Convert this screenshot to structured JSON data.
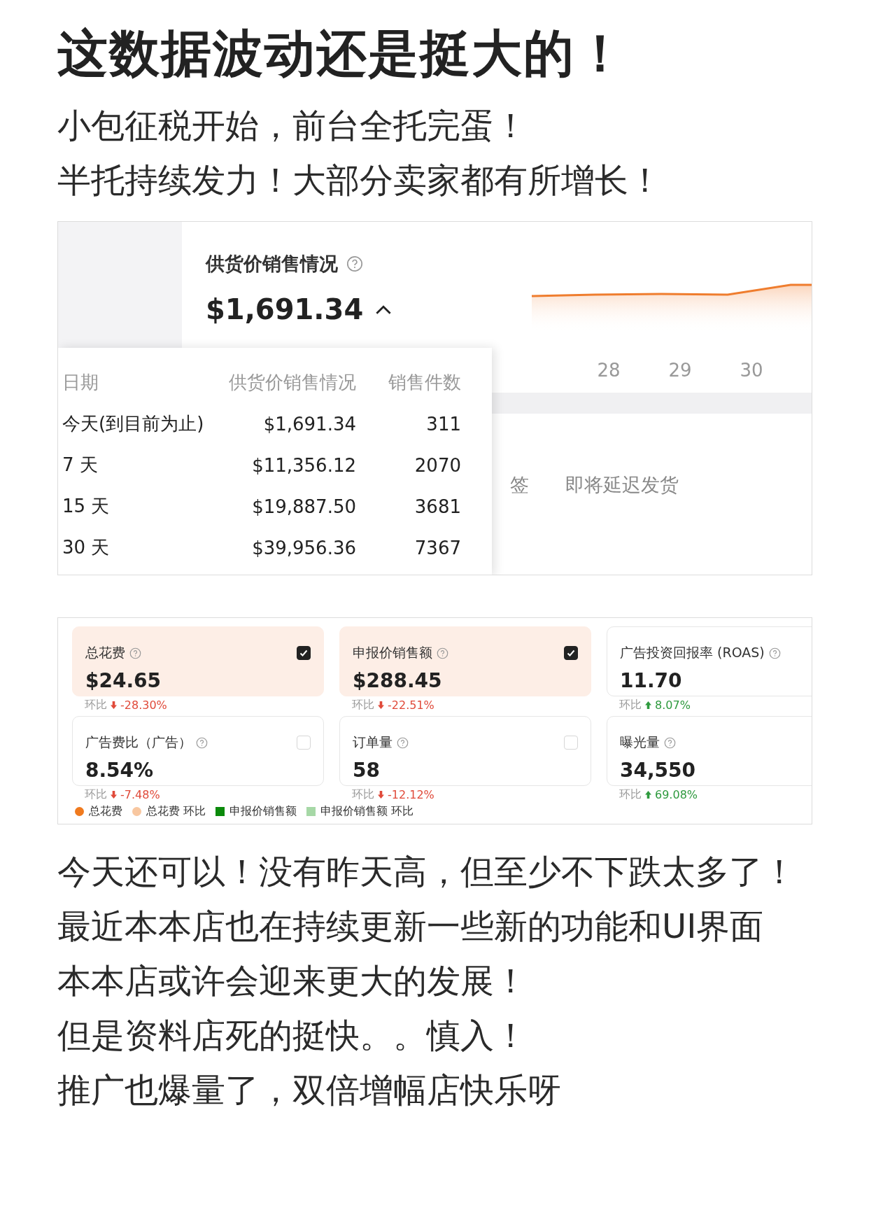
{
  "post": {
    "title": "这数据波动还是挺大的！",
    "intro": [
      "小包征税开始，前台全托完蛋！",
      "半托持续发力！大部分卖家都有所增长！"
    ],
    "body": [
      "今天还可以！没有昨天高，但至少不下跌太多了！",
      "最近本本店也在持续更新一些新的功能和UI界面",
      "本本店或许会迎来更大的发展！",
      "但是资料店死的挺快。。慎入！",
      "推广也爆量了，双倍增幅店快乐呀"
    ]
  },
  "sales_screenshot": {
    "title": "供货价销售情况",
    "amount": "$1,691.34",
    "x_labels": [
      "28",
      "29",
      "30"
    ],
    "tabs": [
      "签",
      "即将延迟发货"
    ],
    "popup": {
      "columns": [
        "日期",
        "供货价销售情况",
        "销售件数"
      ],
      "rows": [
        [
          "今天(到目前为止)",
          "$1,691.34",
          "311"
        ],
        [
          "7 天",
          "$11,356.12",
          "2070"
        ],
        [
          "15 天",
          "$19,887.50",
          "3681"
        ],
        [
          "30 天",
          "$39,956.36",
          "7367"
        ]
      ]
    }
  },
  "ads_screenshot": {
    "metrics": [
      {
        "label": "总花费",
        "value": "$24.65",
        "change_label": "环比",
        "change": "-28.30%",
        "rising": false,
        "checked": true
      },
      {
        "label": "申报价销售额",
        "value": "$288.45",
        "change_label": "环比",
        "change": "-22.51%",
        "rising": false,
        "checked": true
      },
      {
        "label": "广告投资回报率 (ROAS)",
        "value": "11.70",
        "change_label": "环比",
        "change": "8.07%",
        "rising": true
      },
      {
        "label": "广告费比（广告）",
        "value": "8.54%",
        "change_label": "环比",
        "change": "-7.48%",
        "rising": false,
        "checked": false
      },
      {
        "label": "订单量",
        "value": "58",
        "change_label": "环比",
        "change": "-12.12%",
        "rising": false,
        "checked": false
      },
      {
        "label": "曝光量",
        "value": "34,550",
        "change_label": "环比",
        "change": "69.08%",
        "rising": true
      }
    ],
    "legend": [
      {
        "label": "总花费",
        "kind": "dot",
        "color": "#f07a1e"
      },
      {
        "label": "总花费 环比",
        "kind": "dot",
        "color": "#f8c7a0"
      },
      {
        "label": "申报价销售额",
        "kind": "square",
        "color": "#0b8a0b"
      },
      {
        "label": "申报价销售额 环比",
        "kind": "square",
        "color": "#a6d8a6"
      }
    ]
  }
}
